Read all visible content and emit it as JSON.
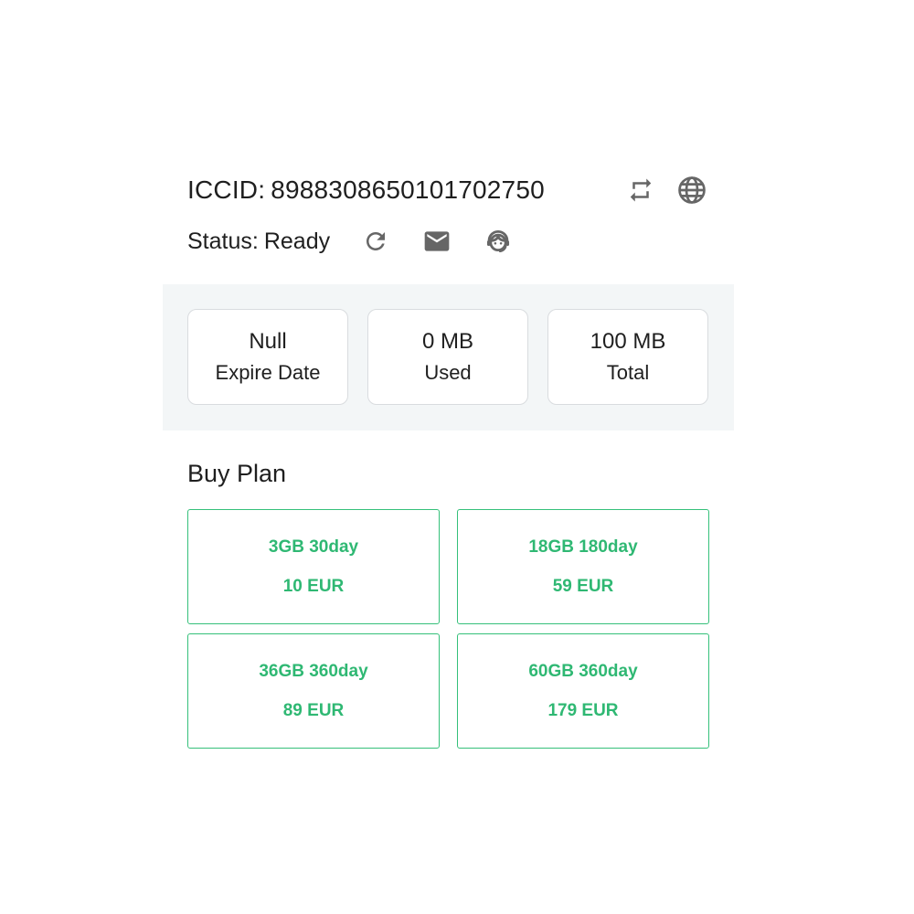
{
  "header": {
    "iccid_label": "ICCID:",
    "iccid_value": "8988308650101702750",
    "status_label": "Status:",
    "status_value": "Ready"
  },
  "icons": {
    "switch": "switch-arrows-icon",
    "globe": "globe-icon",
    "refresh": "refresh-icon",
    "mail": "mail-icon",
    "support": "customer-support-icon"
  },
  "stats": [
    {
      "value": "Null",
      "caption": "Expire Date"
    },
    {
      "value": "0 MB",
      "caption": "Used"
    },
    {
      "value": "100 MB",
      "caption": "Total"
    }
  ],
  "buy_plan": {
    "title": "Buy Plan",
    "plans": [
      {
        "name": "3GB 30day",
        "price": "10 EUR"
      },
      {
        "name": "18GB 180day",
        "price": "59 EUR"
      },
      {
        "name": "36GB 360day",
        "price": "89 EUR"
      },
      {
        "name": "60GB 360day",
        "price": "179 EUR"
      }
    ]
  },
  "colors": {
    "accent_green": "#2fb873",
    "stats_background": "#f3f6f7",
    "icon_gray": "#666666"
  }
}
